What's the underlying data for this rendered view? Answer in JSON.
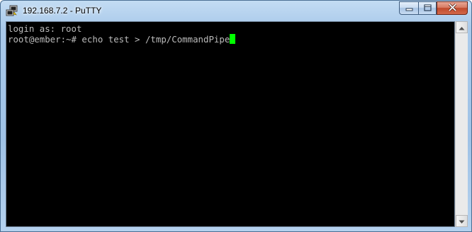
{
  "window": {
    "title": "192.168.7.2 - PuTTY",
    "app_icon": "putty-icon",
    "controls": {
      "minimize_icon": "minimize-icon",
      "maximize_icon": "maximize-icon",
      "close_icon": "close-icon"
    }
  },
  "terminal": {
    "lines": [
      "login as: root",
      "root@ember:~# echo test > /tmp/CommandPipe"
    ],
    "cursor_color": "#00ff00",
    "background": "#000000",
    "foreground": "#bbbbbb"
  },
  "scrollbar": {
    "up_icon": "arrow-up-icon",
    "down_icon": "arrow-down-icon"
  }
}
